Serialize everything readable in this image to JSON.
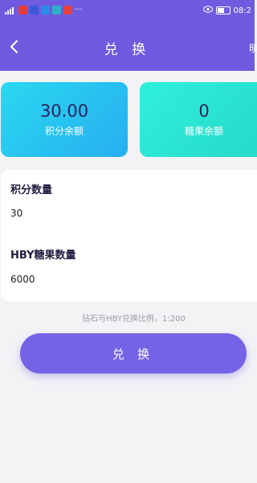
{
  "status_bar": {
    "time": "08:2",
    "more": "···",
    "icons": [
      "signal-icon",
      "notification-red-icon",
      "vpn-shield-icon",
      "app-blue-icon",
      "app-teal-icon",
      "app-red-icon",
      "eye-icon",
      "battery-icon"
    ]
  },
  "header": {
    "title": "兑 换",
    "right_text": "明",
    "back_icon": "chevron-left-icon"
  },
  "balances": {
    "points": {
      "value": "30.00",
      "label": "积分余额"
    },
    "candy": {
      "value": "0",
      "label": "糖果余额"
    }
  },
  "form": {
    "points_label": "积分数量",
    "points_value": "30",
    "candy_label": "HBY糖果数量",
    "candy_value": "6000"
  },
  "ratio_note": "钻石与HBY兑换比例，1:200",
  "submit_label": "兑 换",
  "colors": {
    "header_bg": "#6f5be0",
    "button_bg": "#7563e6",
    "card_points": "#27aef0",
    "card_candy": "#26d8c8"
  }
}
